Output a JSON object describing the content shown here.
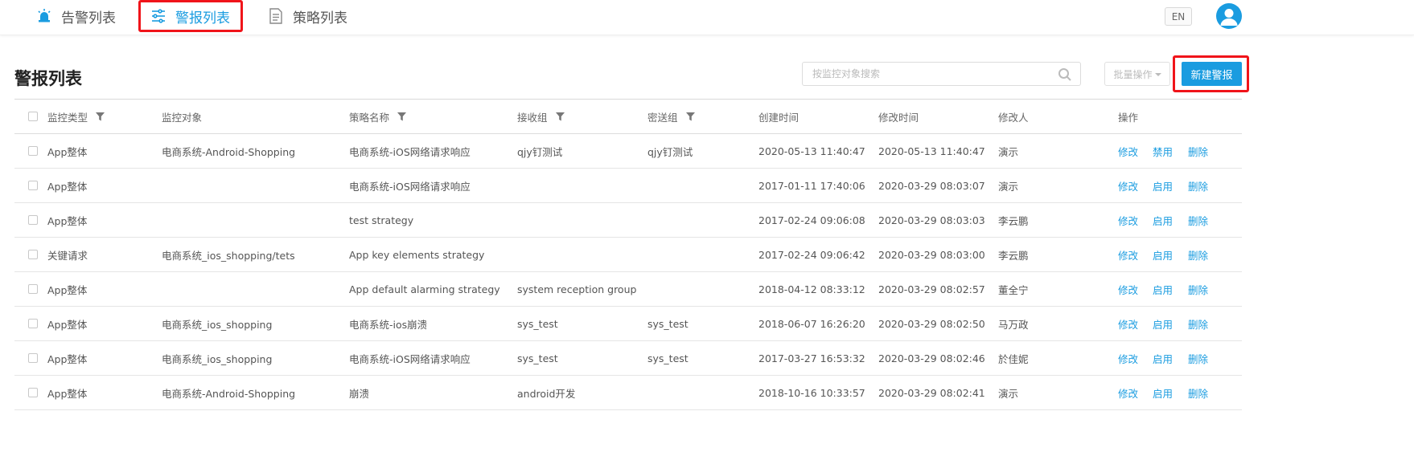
{
  "nav": {
    "tabs": [
      {
        "label": "告警列表",
        "icon": "siren-icon"
      },
      {
        "label": "警报列表",
        "icon": "sliders-icon"
      },
      {
        "label": "策略列表",
        "icon": "document-icon"
      }
    ],
    "active_tab": 1,
    "lang": "EN"
  },
  "page": {
    "title": "警报列表",
    "search_placeholder": "按监控对象搜索",
    "batch_label": "批量操作",
    "new_label": "新建警报"
  },
  "colors": {
    "accent": "#1a9ce0",
    "highlight": "#f0141a"
  },
  "table": {
    "headers": [
      "监控类型",
      "监控对象",
      "策略名称",
      "接收组",
      "密送组",
      "创建时间",
      "修改时间",
      "修改人",
      "操作"
    ],
    "rows": [
      {
        "type": "App整体",
        "target": "电商系统-Android-Shopping",
        "strategy": "电商系统-iOS网络请求响应",
        "recv": "qjy钉测试",
        "bcc": "qjy钉测试",
        "created": "2020-05-13 11:40:47",
        "modified": "2020-05-13 11:40:47",
        "modifier": "演示",
        "edit": "修改",
        "toggle": "禁用",
        "del": "删除"
      },
      {
        "type": "App整体",
        "target": "",
        "strategy": "电商系统-iOS网络请求响应",
        "recv": "",
        "bcc": "",
        "created": "2017-01-11 17:40:06",
        "modified": "2020-03-29 08:03:07",
        "modifier": "演示",
        "edit": "修改",
        "toggle": "启用",
        "del": "删除"
      },
      {
        "type": "App整体",
        "target": "",
        "strategy": "test strategy",
        "recv": "",
        "bcc": "",
        "created": "2017-02-24 09:06:08",
        "modified": "2020-03-29 08:03:03",
        "modifier": "李云鹏",
        "edit": "修改",
        "toggle": "启用",
        "del": "删除"
      },
      {
        "type": "关键请求",
        "target": "电商系统_ios_shopping/tets",
        "strategy": "App key elements strategy",
        "recv": "",
        "bcc": "",
        "created": "2017-02-24 09:06:42",
        "modified": "2020-03-29 08:03:00",
        "modifier": "李云鹏",
        "edit": "修改",
        "toggle": "启用",
        "del": "删除"
      },
      {
        "type": "App整体",
        "target": "",
        "strategy": "App default alarming strategy",
        "recv": "system reception group",
        "bcc": "",
        "created": "2018-04-12 08:33:12",
        "modified": "2020-03-29 08:02:57",
        "modifier": "董全宁",
        "edit": "修改",
        "toggle": "启用",
        "del": "删除"
      },
      {
        "type": "App整体",
        "target": "电商系统_ios_shopping",
        "strategy": "电商系统-ios崩溃",
        "recv": "sys_test",
        "bcc": "sys_test",
        "created": "2018-06-07 16:26:20",
        "modified": "2020-03-29 08:02:50",
        "modifier": "马万政",
        "edit": "修改",
        "toggle": "启用",
        "del": "删除"
      },
      {
        "type": "App整体",
        "target": "电商系统_ios_shopping",
        "strategy": "电商系统-iOS网络请求响应",
        "recv": "sys_test",
        "bcc": "sys_test",
        "created": "2017-03-27 16:53:32",
        "modified": "2020-03-29 08:02:46",
        "modifier": "於佳妮",
        "edit": "修改",
        "toggle": "启用",
        "del": "删除"
      },
      {
        "type": "App整体",
        "target": "电商系统-Android-Shopping",
        "strategy": "崩溃",
        "recv": "android开发",
        "bcc": "",
        "created": "2018-10-16 10:33:57",
        "modified": "2020-03-29 08:02:41",
        "modifier": "演示",
        "edit": "修改",
        "toggle": "启用",
        "del": "删除"
      }
    ]
  }
}
